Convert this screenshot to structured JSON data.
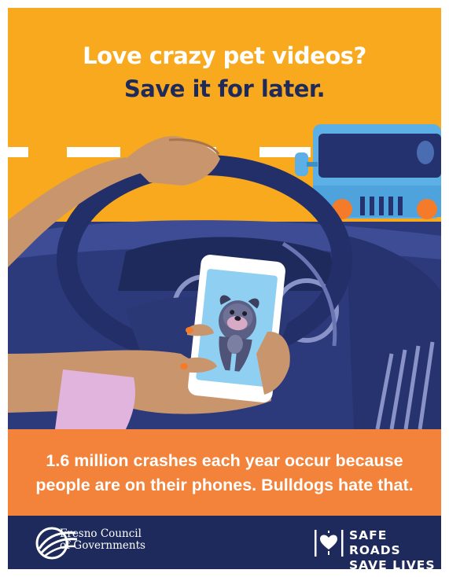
{
  "headline": {
    "line1": "Love crazy pet videos?",
    "line2": "Save it for later."
  },
  "banner": {
    "line1": "1.6 million crashes each year occur because",
    "line2": "people are on their phones. Bulldogs hate that."
  },
  "footer": {
    "org_line1": "Fresno Council",
    "org_line2": "of Governments",
    "campaign_line1": "SAFE ROADS",
    "campaign_line2": "SAVE LIVES"
  },
  "colors": {
    "sky_orange": "#f8a91e",
    "banner_orange": "#f3823a",
    "navy": "#1e2a5b",
    "headline_dark": "#1f2a5c",
    "truck_blue": "#5cb0e6",
    "phone_screen": "#8fd0f2"
  },
  "icons": [
    "fresno-cog-logo-icon",
    "heart-road-icon"
  ]
}
